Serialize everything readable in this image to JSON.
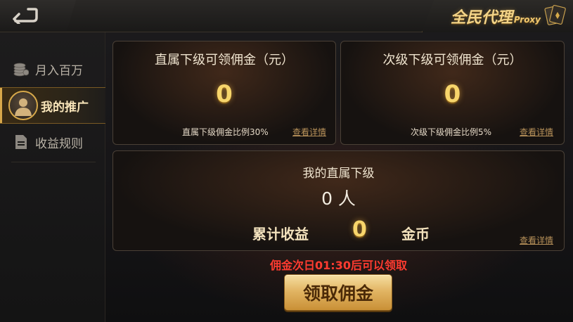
{
  "header": {
    "title": "全民代理",
    "title_suffix": "Proxy",
    "back_icon": "back-arrow-icon"
  },
  "sidebar": {
    "items": [
      {
        "label": "月入百万",
        "icon": "coin-stack-icon",
        "active": false
      },
      {
        "label": "我的推广",
        "icon": "avatar-icon",
        "active": true
      },
      {
        "label": "收益规则",
        "icon": "document-icon",
        "active": false
      }
    ]
  },
  "direct_panel": {
    "title": "直属下级可领佣金（元）",
    "amount": "0",
    "ratio_text": "直属下级佣金比例30%",
    "detail_link": "查看详情"
  },
  "secondary_panel": {
    "title": "次级下级可领佣金（元）",
    "amount": "0",
    "ratio_text": "次级下级佣金比例5%",
    "detail_link": "查看详情"
  },
  "subordinates_panel": {
    "title": "我的直属下级",
    "count": "0 人",
    "earnings_label": "累计收益",
    "earnings_value": "0",
    "earnings_unit": "金币",
    "detail_link": "查看详情"
  },
  "claim": {
    "notice": "佣金次日01:30后可以领取",
    "button_label": "领取佣金"
  },
  "colors": {
    "accent_gold": "#f7d56b",
    "notice_red": "#ff3b30",
    "link_brown": "#b8925a"
  }
}
